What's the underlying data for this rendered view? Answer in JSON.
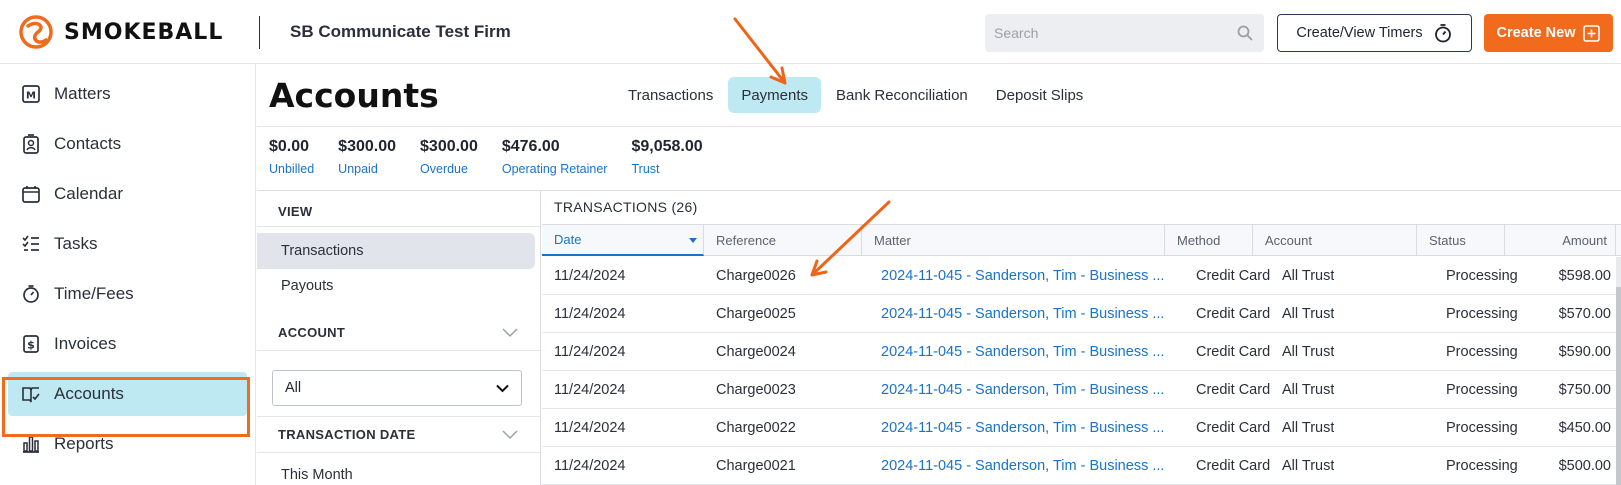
{
  "header": {
    "logo_text": "SMOKEBALL",
    "firm_name": "SB Communicate Test Firm",
    "search_placeholder": "Search",
    "timers_label": "Create/View Timers",
    "create_new_label": "Create New"
  },
  "sidebar": {
    "items": [
      {
        "label": "Matters",
        "icon": "matters-icon"
      },
      {
        "label": "Contacts",
        "icon": "contacts-icon"
      },
      {
        "label": "Calendar",
        "icon": "calendar-icon"
      },
      {
        "label": "Tasks",
        "icon": "tasks-icon"
      },
      {
        "label": "Time/Fees",
        "icon": "stopwatch-icon"
      },
      {
        "label": "Invoices",
        "icon": "invoice-icon"
      },
      {
        "label": "Accounts",
        "icon": "ledger-icon",
        "active": true
      },
      {
        "label": "Reports",
        "icon": "bar-chart-icon"
      }
    ]
  },
  "page": {
    "title": "Accounts",
    "tabs": [
      {
        "label": "Transactions"
      },
      {
        "label": "Payments",
        "active": true
      },
      {
        "label": "Bank Reconciliation"
      },
      {
        "label": "Deposit Slips"
      }
    ]
  },
  "summary": [
    {
      "value": "$0.00",
      "label": "Unbilled"
    },
    {
      "value": "$300.00",
      "label": "Unpaid"
    },
    {
      "value": "$300.00",
      "label": "Overdue"
    },
    {
      "value": "$476.00",
      "label": "Operating Retainer"
    },
    {
      "value": "$9,058.00",
      "label": "Trust"
    }
  ],
  "filters": {
    "view_heading": "VIEW",
    "view_items": [
      "Transactions",
      "Payouts"
    ],
    "account_heading": "ACCOUNT",
    "account_value": "All",
    "date_heading": "TRANSACTION DATE",
    "date_first_option": "This Month"
  },
  "table": {
    "title": "TRANSACTIONS (26)",
    "columns": [
      "Date",
      "Reference",
      "Matter",
      "Method",
      "Account",
      "Status",
      "Amount"
    ],
    "rows": [
      {
        "date": "11/24/2024",
        "reference": "Charge0026",
        "matter": "2024-11-045 - Sanderson, Tim - Business ...",
        "method": "Credit Card",
        "account": "All Trust",
        "status": "Processing",
        "amount": "$598.00"
      },
      {
        "date": "11/24/2024",
        "reference": "Charge0025",
        "matter": "2024-11-045 - Sanderson, Tim - Business ...",
        "method": "Credit Card",
        "account": "All Trust",
        "status": "Processing",
        "amount": "$570.00"
      },
      {
        "date": "11/24/2024",
        "reference": "Charge0024",
        "matter": "2024-11-045 - Sanderson, Tim - Business ...",
        "method": "Credit Card",
        "account": "All Trust",
        "status": "Processing",
        "amount": "$590.00"
      },
      {
        "date": "11/24/2024",
        "reference": "Charge0023",
        "matter": "2024-11-045 - Sanderson, Tim - Business ...",
        "method": "Credit Card",
        "account": "All Trust",
        "status": "Processing",
        "amount": "$750.00"
      },
      {
        "date": "11/24/2024",
        "reference": "Charge0022",
        "matter": "2024-11-045 - Sanderson, Tim - Business ...",
        "method": "Credit Card",
        "account": "All Trust",
        "status": "Processing",
        "amount": "$450.00"
      },
      {
        "date": "11/24/2024",
        "reference": "Charge0021",
        "matter": "2024-11-045 - Sanderson, Tim - Business ...",
        "method": "Credit Card",
        "account": "All Trust",
        "status": "Processing",
        "amount": "$500.00"
      }
    ]
  },
  "colors": {
    "brand_orange": "#f26a1b",
    "active_bg": "#bfe9f2",
    "link_blue": "#1a73c8"
  }
}
